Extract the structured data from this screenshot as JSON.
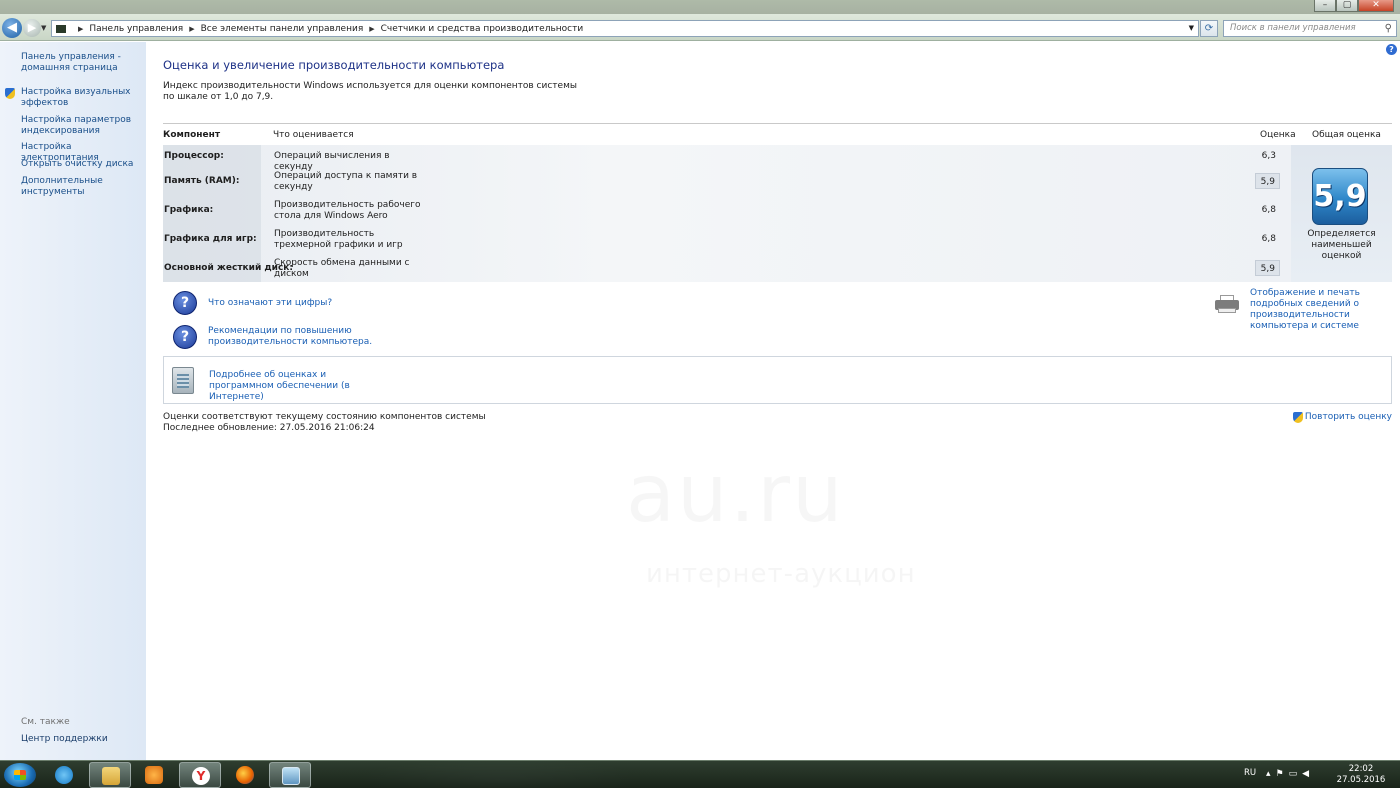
{
  "window": {
    "controls": {
      "minimize": "–",
      "maximize": "▢",
      "close": "✕"
    }
  },
  "address": {
    "crumbs": [
      "Панель управления",
      "Все элементы панели управления",
      "Счетчики и средства производительности"
    ],
    "search_placeholder": "Поиск в панели управления"
  },
  "sidebar": {
    "items": [
      {
        "label": "Панель управления - домашняя страница"
      },
      {
        "label": "Настройка визуальных эффектов"
      },
      {
        "label": "Настройка параметров индексирования"
      },
      {
        "label": "Настройка электропитания"
      },
      {
        "label": "Открыть очистку диска"
      },
      {
        "label": "Дополнительные инструменты"
      }
    ],
    "see_also": "См. также",
    "support": "Центр поддержки"
  },
  "main": {
    "title": "Оценка и увеличение производительности компьютера",
    "description": "Индекс производительности Windows используется для оценки компонентов системы по шкале от 1,0 до 7,9.",
    "table": {
      "headers": {
        "component": "Компонент",
        "what": "Что оценивается",
        "score": "Оценка",
        "overall": "Общая оценка"
      },
      "rows": [
        {
          "component": "Процессор:",
          "what": "Операций вычисления в секунду",
          "score": "6,3"
        },
        {
          "component": "Память (RAM):",
          "what": "Операций доступа к памяти в секунду",
          "score": "5,9"
        },
        {
          "component": "Графика:",
          "what": "Производительность рабочего стола для Windows Aero",
          "score": "6,8"
        },
        {
          "component": "Графика для игр:",
          "what": "Производительность трехмерной графики и игр",
          "score": "6,8"
        },
        {
          "component": "Основной жесткий диск:",
          "what": "Скорость обмена данными с диском",
          "score": "5,9"
        }
      ],
      "overall_score": "5,9",
      "overall_caption": "Определяется наименьшей оценкой"
    },
    "links": {
      "what_numbers": "Что означают эти цифры?",
      "recommendations": "Рекомендации по повышению производительности компьютера.",
      "print_details": "Отображение и печать подробных сведений о производительности компьютера и системе",
      "more_info": "Подробнее об оценках и программном обеспечении (в Интернете)"
    },
    "status": {
      "current": "Оценки соответствуют текущему состоянию компонентов системы",
      "last_update": "Последнее обновление: 27.05.2016 21:06:24"
    },
    "rerun": "Повторить оценку",
    "watermark": {
      "big": "au.ru",
      "small": "интернет-аукцион"
    }
  },
  "taskbar": {
    "language": "RU",
    "time": "22:02",
    "date": "27.05.2016"
  }
}
